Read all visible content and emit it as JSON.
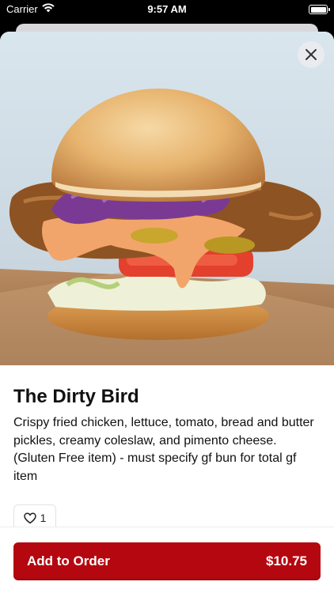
{
  "status_bar": {
    "carrier": "Carrier",
    "time": "9:57 AM",
    "battery_level": 1.0
  },
  "item": {
    "title": "The Dirty Bird",
    "description": "Crispy fried chicken, lettuce, tomato, bread and butter pickles, creamy coleslaw, and pimento cheese. (Gluten Free item) - must specify gf bun for total gf item",
    "like_count": "1",
    "image": "fried-chicken-sandwich-photo"
  },
  "order_button": {
    "label": "Add to Order",
    "price": "$10.75"
  },
  "icons": {
    "close": "close-icon",
    "heart": "heart-icon",
    "wifi": "wifi-icon",
    "battery": "battery-icon"
  },
  "colors": {
    "accent": "#b5070f",
    "text": "#111111",
    "background": "#ffffff"
  }
}
